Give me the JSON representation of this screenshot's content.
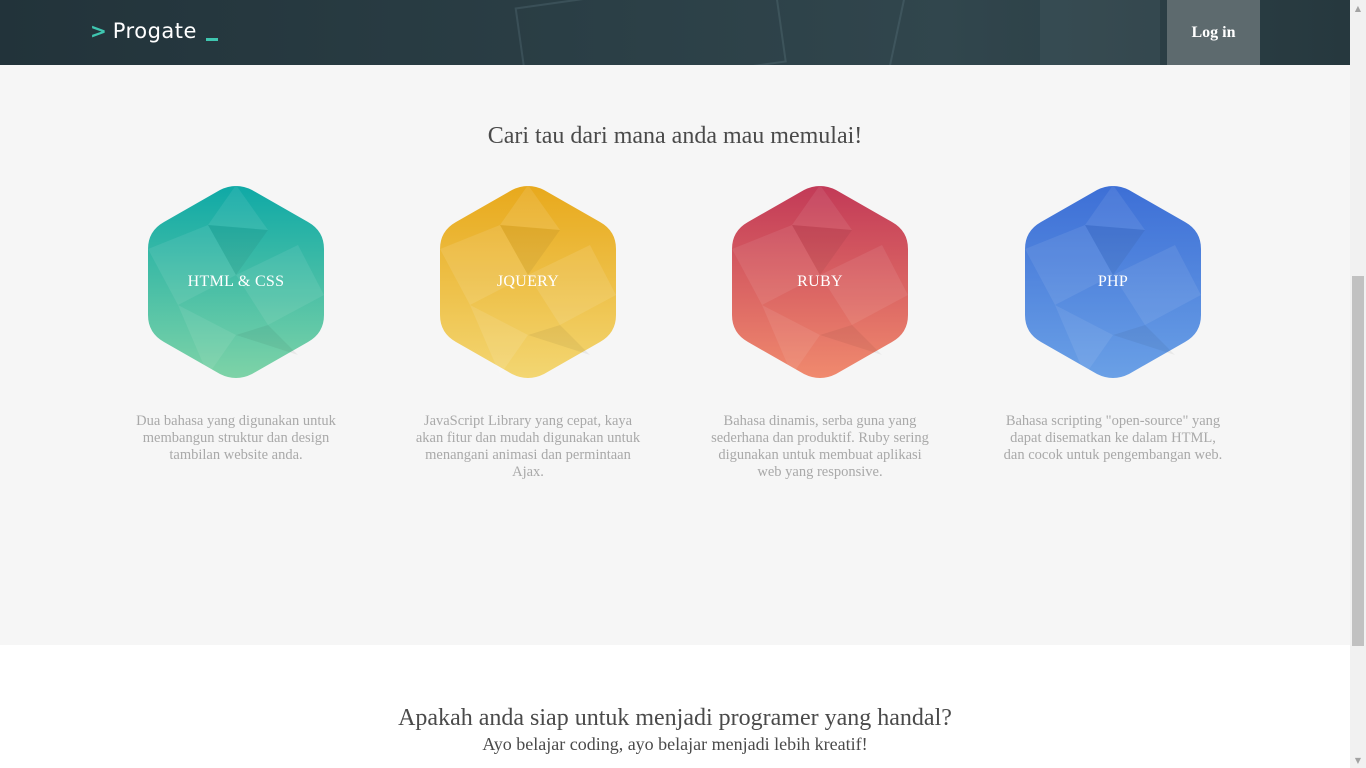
{
  "header": {
    "logo_chevron": ">",
    "logo_text": "Progate",
    "login_label": "Log in"
  },
  "courses": {
    "heading": "Cari tau dari mana anda mau memulai!",
    "items": [
      {
        "label": "HTML & CSS",
        "color_top": "#0fa9a6",
        "color_bottom": "#7ed3a7",
        "description": "Dua bahasa yang digunakan untuk membangun struktur dan design tambilan website anda."
      },
      {
        "label": "JQUERY",
        "color_top": "#e8a91c",
        "color_bottom": "#f3d672",
        "description": "JavaScript Library yang cepat, kaya akan fitur dan mudah digunakan untuk menangani animasi dan permintaan Ajax."
      },
      {
        "label": "RUBY",
        "color_top": "#c23a57",
        "color_bottom": "#f08a6e",
        "description": "Bahasa dinamis, serba guna yang sederhana dan produktif. Ruby sering digunakan untuk membuat aplikasi web yang responsive."
      },
      {
        "label": "PHP",
        "color_top": "#3d6fd6",
        "color_bottom": "#6aa0e6",
        "description": "Bahasa scripting \"open-source\" yang dapat disematkan ke dalam HTML, dan cocok untuk pengembangan web."
      }
    ]
  },
  "cta": {
    "heading": "Apakah anda siap untuk menjadi programer yang handal?",
    "subheading": "Ayo belajar coding, ayo belajar menjadi lebih kreatif!"
  },
  "scrollbar": {
    "up_arrow": "▲",
    "down_arrow": "▼"
  }
}
